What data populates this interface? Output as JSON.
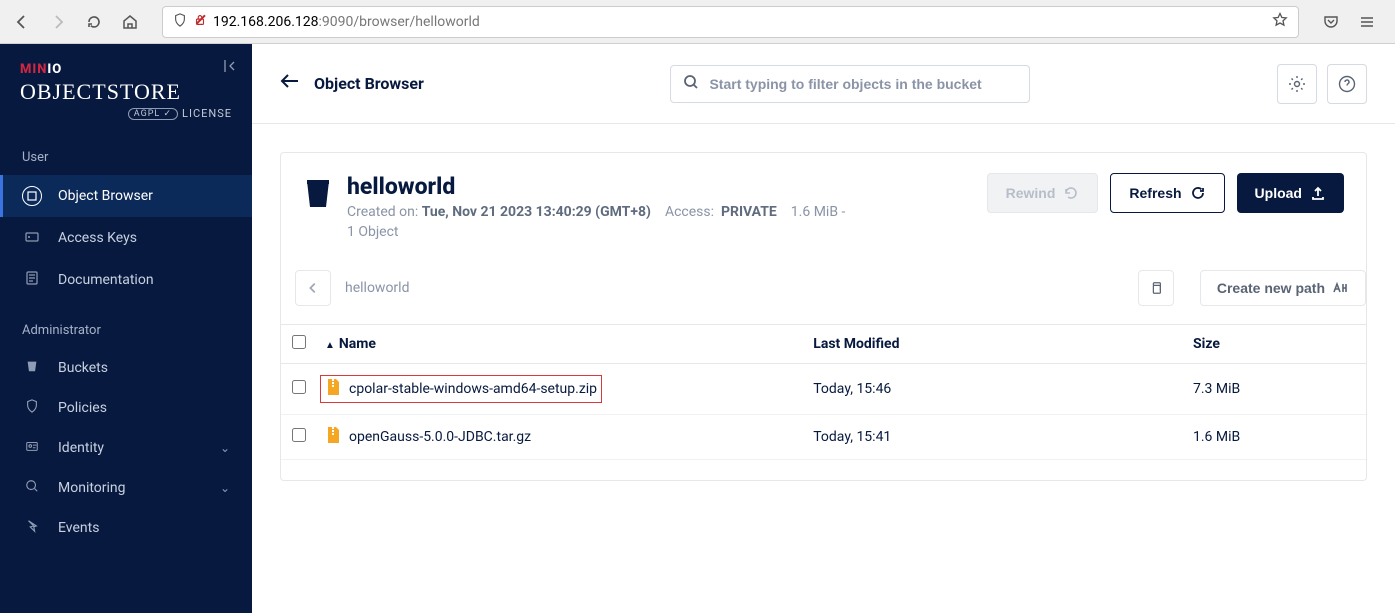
{
  "url": {
    "host": "192.168.206.128",
    "path": ":9090/browser/helloworld"
  },
  "sidebar": {
    "section_user_label": "User",
    "items_user": [
      {
        "label": "Object Browser"
      },
      {
        "label": "Access Keys"
      },
      {
        "label": "Documentation"
      }
    ],
    "section_admin_label": "Administrator",
    "items_admin": [
      {
        "label": "Buckets"
      },
      {
        "label": "Policies"
      },
      {
        "label": "Identity"
      },
      {
        "label": "Monitoring"
      },
      {
        "label": "Events"
      }
    ]
  },
  "header": {
    "title": "Object Browser",
    "search_placeholder": "Start typing to filter objects in the bucket"
  },
  "bucket": {
    "name": "helloworld",
    "created_label": "Created on:",
    "created_value": "Tue, Nov 21 2023 13:40:29 (GMT+8)",
    "access_label": "Access:",
    "access_value": "PRIVATE",
    "size_summary": "1.6 MiB -",
    "object_count": "1 Object"
  },
  "actions": {
    "rewind": "Rewind",
    "refresh": "Refresh",
    "upload": "Upload",
    "create_path": "Create new path"
  },
  "path": {
    "crumb": "helloworld"
  },
  "table": {
    "headers": {
      "name": "Name",
      "modified": "Last Modified",
      "size": "Size"
    },
    "rows": [
      {
        "name": "cpolar-stable-windows-amd64-setup.zip",
        "modified": "Today, 15:46",
        "size": "7.3 MiB",
        "highlighted": true
      },
      {
        "name": "openGauss-5.0.0-JDBC.tar.gz",
        "modified": "Today, 15:41",
        "size": "1.6 MiB",
        "highlighted": false
      }
    ]
  }
}
